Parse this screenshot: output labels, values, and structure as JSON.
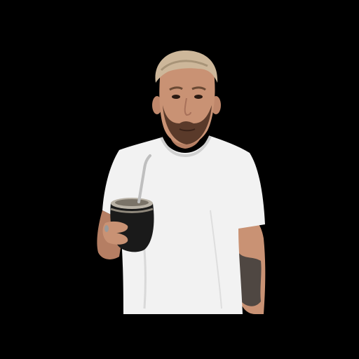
{
  "scene": {
    "subject": "person-in-white-tshirt-holding-mate-gourd",
    "colors": {
      "background": "#000000",
      "shirt": "#f2f2f2",
      "shirt_shadow": "#d9d9d9",
      "skin": "#c99274",
      "skin_shadow": "#a8715a",
      "hair": "#cdb79a",
      "beard": "#5a3a2a",
      "gourd": "#1a1a1a",
      "gourd_rim": "#b9b2a6",
      "straw": "#bfbfbf",
      "tattoo": "#3a3a3a"
    }
  }
}
